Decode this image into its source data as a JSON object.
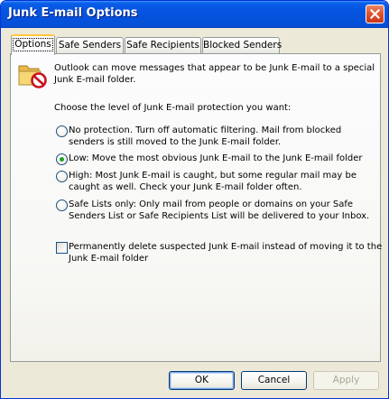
{
  "window": {
    "title": "Junk E-mail Options",
    "close_icon": "close-icon"
  },
  "tabs": [
    {
      "label": "Options",
      "active": true
    },
    {
      "label": "Safe Senders",
      "active": false
    },
    {
      "label": "Safe Recipients",
      "active": false
    },
    {
      "label": "Blocked Senders",
      "active": false
    }
  ],
  "options": {
    "intro_icon": "junk-folder-icon",
    "intro_line1": "Outlook can move messages that appear to be Junk E-mail to a special",
    "intro_line2": "Junk E-mail folder.",
    "choose_label": "Choose the level of Junk E-mail protection you want:",
    "levels": [
      {
        "line1": "No protection.  Turn off automatic filtering.  Mail from blocked",
        "line2": "senders is still moved to the Junk E-mail folder.",
        "checked": false
      },
      {
        "line1": "Low: Move the most obvious Junk E-mail to the Junk E-mail folder",
        "line2": "",
        "checked": true
      },
      {
        "line1": "High: Most Junk E-mail is caught, but some regular mail may be",
        "line2": "caught as well. Check your Junk E-mail folder often.",
        "checked": false
      },
      {
        "line1": "Safe Lists only: Only mail from people or domains on your Safe",
        "line2": "Senders List or Safe Recipients List will be delivered to your Inbox.",
        "checked": false
      }
    ],
    "delete_checkbox": {
      "line1": "Permanently delete suspected Junk E-mail instead of moving it to the",
      "line2": "Junk E-mail folder",
      "checked": false
    }
  },
  "buttons": {
    "ok": "OK",
    "cancel": "Cancel",
    "apply": "Apply",
    "apply_enabled": false
  },
  "colors": {
    "title_bar": "#0553e0",
    "dialog_face": "#ece9d8",
    "active_tab_accent": "#ffc83c",
    "radio_selected": "#21a121"
  }
}
